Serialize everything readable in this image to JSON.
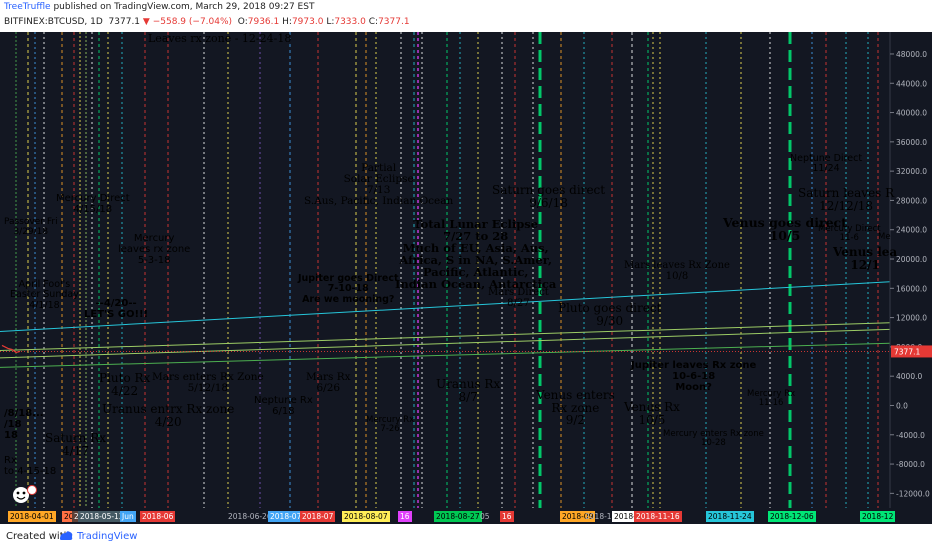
{
  "header": {
    "author": "TreeTruffle",
    "published": "published on TradingView.com, March 29, 2018 09:27 EST",
    "symbol": "BITFINEX:BTCUSD, 1D",
    "last": "7377.1",
    "change": "−558.9 (−7.04%)",
    "open_label": "O:",
    "open": "7936.1",
    "high_label": "H:",
    "high": "7973.0",
    "low_label": "L:",
    "low": "7333.0",
    "close_label": "C:",
    "close": "7377.1"
  },
  "footer": {
    "created_with": "Created with",
    "brand": "TradingView"
  },
  "colors": {
    "background": "#131722",
    "price_line": "#e53935",
    "trend_cyan": "#26c6da",
    "trend_green": "#9ccc65",
    "trend_green2": "#4caf50"
  },
  "chart_data": {
    "type": "line",
    "title": "",
    "price_axis": {
      "ticks": [
        "48000.0",
        "44000.0",
        "40000.0",
        "36000.0",
        "32000.0",
        "28000.0",
        "24000.0",
        "20000.0",
        "16000.0",
        "12000.0",
        "8000.0",
        "4000.0",
        "0.0",
        "-4000.0",
        "-8000.0",
        "-12000.0"
      ],
      "current": "7377.1",
      "ylim": [
        -14000,
        51000
      ]
    },
    "time_axis": {
      "labels": [
        "2018-04-01",
        "2018-04-22",
        "2018-05",
        "2018-05-12",
        "Jun",
        "2018-06",
        "2018-06-26",
        "2018-07-13",
        "2018-07",
        "2018-08-07",
        "16",
        "2018-08-27",
        "05",
        "16",
        "2018-09",
        "2018-10-08",
        "2018-10-28",
        "2018-11-16",
        "2018-11-24",
        "2018-12-06",
        "2018-12"
      ]
    },
    "series": [
      {
        "values": [
          7377.1
        ]
      }
    ],
    "annotations": [
      {
        "text": "Leaves rx zone - 12-24-18",
        "color": "#ffffff"
      },
      {
        "text": "Partial\nSolar Eclipse\n7/13\nS.Aus, Pacific, Indian Ocean",
        "color": "#ffa726"
      },
      {
        "text": "Saturn goes direct\n9/6/18",
        "color": "#ef5350"
      },
      {
        "text": "Neptune Direct\n11/24",
        "color": "#5c9cff"
      },
      {
        "text": "Saturn leaves R\n12/12/18",
        "color": "#ef5350"
      },
      {
        "text": "Mercury Direct\n4/15/18",
        "color": "#26c6da"
      },
      {
        "text": "Passover Fri\n3/29/18",
        "color": "#e040fb"
      },
      {
        "text": "Mercury\nleaves rx zone\n5-3-18",
        "color": "#26c6da"
      },
      {
        "text": "Total Lunar Eclipse\n7/27 to 28\nMuch of EU, Asia, Aus,\nAfrica, S in NA, S.Amer,\nPacific, Atlantic,\nIndian Ocean, Antarctica",
        "color": "#e040fb"
      },
      {
        "text": "Venus goes direct\n10/5",
        "color": "#00e676"
      },
      {
        "text": "Mercury Direct\n11-6",
        "color": "#26c6da"
      },
      {
        "text": "Me",
        "color": "#26c6da"
      },
      {
        "text": "Venus lea\n12/1",
        "color": "#00e676"
      },
      {
        "text": "Mars leaves Rx Zone\n10/8",
        "color": "#e53935"
      },
      {
        "text": "April Fool's\nEaster Sunday\n4/1/18",
        "color": "#ffee58"
      },
      {
        "text": "Jupiter goes Direct\n7-10-18\nAre we mooning?",
        "color": "#ffee58"
      },
      {
        "text": "Mars Direct\n8/27",
        "color": "#e53935"
      },
      {
        "text": "Pluto goes direct\n9/30",
        "color": "#d1d4dc"
      },
      {
        "text": "--4/20--\nLET'S GO!!!",
        "color": "#43a047"
      },
      {
        "text": "Pluto Rx\n4/22",
        "color": "#d1d4dc"
      },
      {
        "text": "Mars enters Rx Zone\n5/12/18",
        "color": "#e53935"
      },
      {
        "text": "Mars Rx\n6/26",
        "color": "#e53935"
      },
      {
        "text": "Uranus Rx\n8/7",
        "color": "#7cb342"
      },
      {
        "text": "Venus enters\nRx zone\n9/2",
        "color": "#00e676"
      },
      {
        "text": "Jupiter leaves Rx zone\n10-6-18\nMoon?",
        "color": "#ffee58"
      },
      {
        "text": "Uranus entrx Rx zone\n4/20",
        "color": "#7cb342"
      },
      {
        "text": "Neptune Rx\n6/18",
        "color": "#5c9cff"
      },
      {
        "text": "Venus Rx\n10/5",
        "color": "#00e676"
      },
      {
        "text": "Mercury Rx\n11-16",
        "color": "#26c6da"
      },
      {
        "text": "/8/18...\n/18\n18",
        "color": "#ffee58"
      },
      {
        "text": "Mercury Rx\n7-26",
        "color": "#26c6da"
      },
      {
        "text": "Mercury enters Rx zone\n10-28",
        "color": "#26c6da"
      },
      {
        "text": "Saturn Rx\n4/17",
        "color": "#ef5350"
      },
      {
        "text": "Rx\nto 4-15-18",
        "color": "#26c6da"
      }
    ]
  }
}
